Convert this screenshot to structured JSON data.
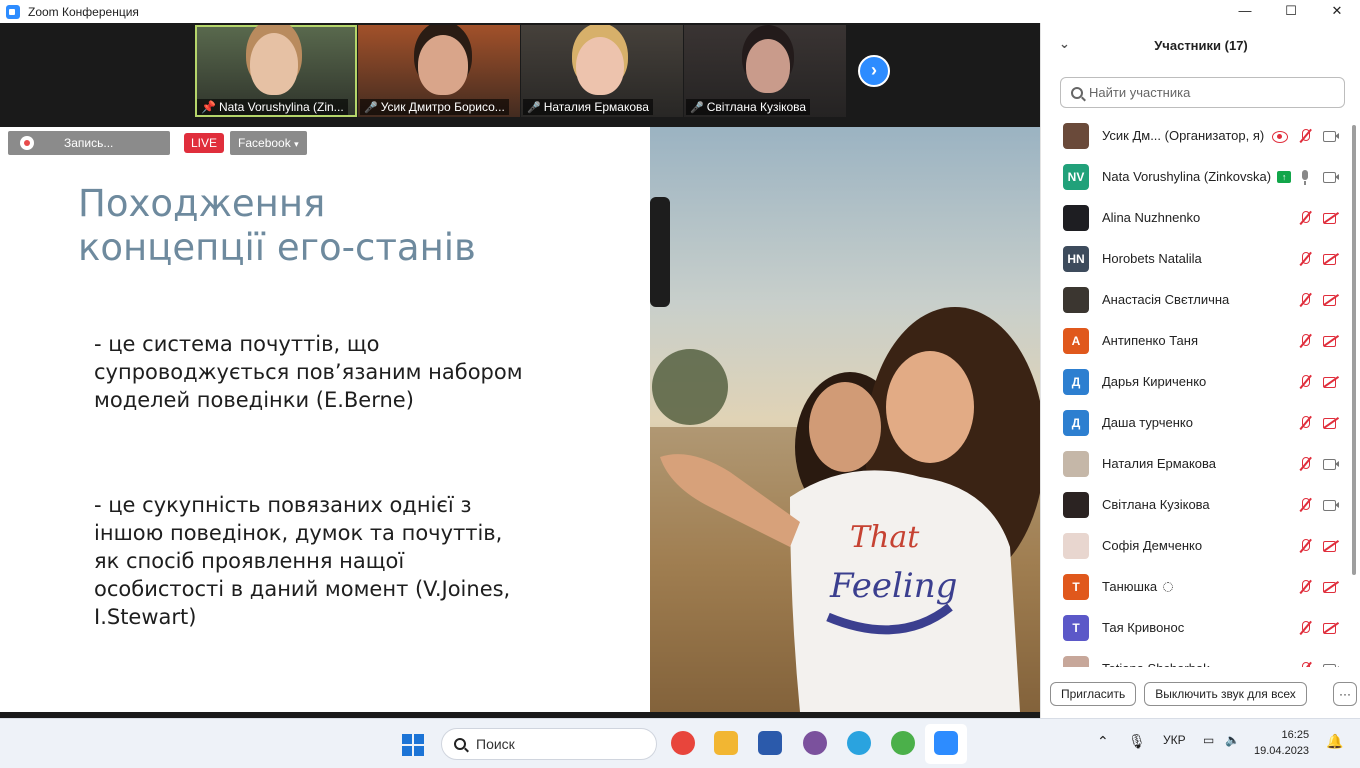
{
  "window": {
    "title": "Zoom Конференция",
    "controls": [
      "—",
      "☐",
      "✕"
    ]
  },
  "gallery": {
    "tiles": [
      {
        "name": "Nata Vorushylina (Zin...",
        "pinned": true,
        "muted": false,
        "active": true,
        "bg": "#5a6a4e",
        "face": "#e6c1a4",
        "hair": "#b98b5e"
      },
      {
        "name": "Усик Дмитро Борисо...",
        "pinned": false,
        "muted": true,
        "active": false,
        "bg": "#a2512a",
        "face": "#d9a58a",
        "hair": "#2a1c14"
      },
      {
        "name": "Наталия Ермакова",
        "pinned": false,
        "muted": true,
        "active": false,
        "bg": "#46413b",
        "face": "#edc3ad",
        "hair": "#d7b06a"
      },
      {
        "name": "Світлана Кузікова",
        "pinned": false,
        "muted": true,
        "active": false,
        "bg": "#3a3433",
        "face": "#c99b8b",
        "hair": "#231b1b"
      }
    ],
    "next_arrow": "›"
  },
  "recording": {
    "label": "Запись...",
    "live_label": "LIVE",
    "stream_label": "Facebook",
    "stream_caret": "▾"
  },
  "slide": {
    "title_line1": "Походження",
    "title_line2": "концепції его-станів",
    "para1": "- це система почуттів, що супроводжується пов’язаним набором моделей поведінки (E.Berne)",
    "para2": "- це сукупність повязаних однієї з іншою поведінок, думок та почуттів, як спосіб проявлення нащої особистості в даний момент (V.Joines, I.Stewart)",
    "photo_shirt_text_1": "That",
    "photo_shirt_text_2": "Feeling"
  },
  "participants": {
    "header": "Участники (17)",
    "search_placeholder": "Найти участника",
    "list": [
      {
        "name": "Усик Дм...  (Организатор, я)",
        "avatar_text": "",
        "avatar_color": "#6a4a3a",
        "extra": "rec",
        "mic": "muted",
        "cam": "on"
      },
      {
        "name": "Nata Vorushylina (Zinkovska)",
        "avatar_text": "NV",
        "avatar_color": "#21a17a",
        "extra": "up",
        "mic": "on",
        "cam": "on"
      },
      {
        "name": "Alina Nuzhnenko",
        "avatar_text": "",
        "avatar_color": "#1e1e22",
        "extra": "",
        "mic": "muted",
        "cam": "off"
      },
      {
        "name": "Horobets Natalila",
        "avatar_text": "HN",
        "avatar_color": "#3d4b5c",
        "extra": "",
        "mic": "muted",
        "cam": "off"
      },
      {
        "name": "Анастасія Свєтлична",
        "avatar_text": "",
        "avatar_color": "#3b3630",
        "extra": "",
        "mic": "muted",
        "cam": "off"
      },
      {
        "name": "Антипенко Таня",
        "avatar_text": "А",
        "avatar_color": "#e0581c",
        "extra": "",
        "mic": "muted",
        "cam": "off"
      },
      {
        "name": "Дарья Кириченко",
        "avatar_text": "Д",
        "avatar_color": "#2d7fd0",
        "extra": "",
        "mic": "muted",
        "cam": "off"
      },
      {
        "name": "Даша турченко",
        "avatar_text": "Д",
        "avatar_color": "#2d7fd0",
        "extra": "",
        "mic": "muted",
        "cam": "off"
      },
      {
        "name": "Наталия Ермакова",
        "avatar_text": "",
        "avatar_color": "#c5b7a8",
        "extra": "",
        "mic": "muted",
        "cam": "on"
      },
      {
        "name": "Світлана Кузікова",
        "avatar_text": "",
        "avatar_color": "#2b2322",
        "extra": "",
        "mic": "muted",
        "cam": "on"
      },
      {
        "name": "Софія Демченко",
        "avatar_text": "",
        "avatar_color": "#e8d6cf",
        "extra": "",
        "mic": "muted",
        "cam": "off"
      },
      {
        "name": "Танюшка",
        "avatar_text": "Т",
        "avatar_color": "#e0581c",
        "extra": "spin",
        "mic": "muted",
        "cam": "off"
      },
      {
        "name": "Тая Кривонос",
        "avatar_text": "Т",
        "avatar_color": "#5b58c8",
        "extra": "",
        "mic": "muted",
        "cam": "off"
      },
      {
        "name": "Tetiana Shcherbak",
        "avatar_text": "",
        "avatar_color": "#c7a79a",
        "extra": "",
        "mic": "muted",
        "cam": "on"
      }
    ],
    "invite_label": "Пригласить",
    "mute_all_label": "Выключить звук для всех",
    "more_label": "···"
  },
  "taskbar": {
    "search_label": "Поиск",
    "lang": "УКР",
    "time": "16:25",
    "date": "19.04.2023",
    "apps": [
      {
        "name": "chrome-icon",
        "color": "#e8453c"
      },
      {
        "name": "file-explorer-icon",
        "color": "#f2b632"
      },
      {
        "name": "word-icon",
        "color": "#2b5aab"
      },
      {
        "name": "viber-icon",
        "color": "#7b519d"
      },
      {
        "name": "telegram-icon",
        "color": "#2aa3df"
      },
      {
        "name": "maps-icon",
        "color": "#4bb04a"
      },
      {
        "name": "zoom-icon",
        "color": "#2d8cff"
      }
    ]
  }
}
